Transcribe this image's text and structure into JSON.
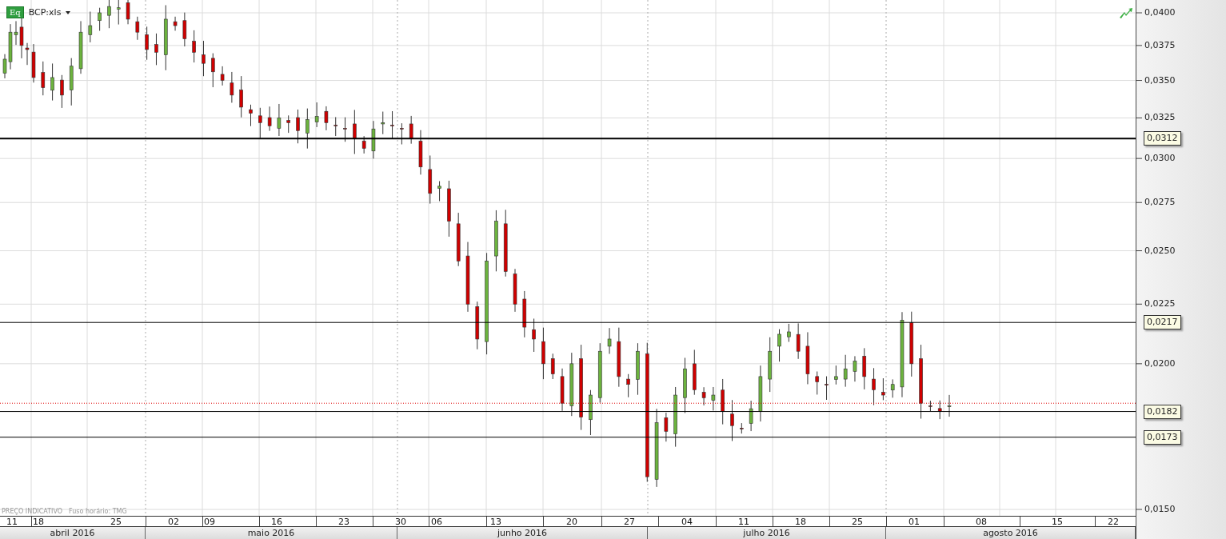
{
  "header": {
    "badge": "Eq",
    "symbol": "BCP:xls"
  },
  "y_axis": {
    "tick_labels": [
      "0,0400",
      "0,0375",
      "0,0350",
      "0,0325",
      "0,0300",
      "0,0275",
      "0,0250",
      "0,0225",
      "0,0200",
      "0,0150"
    ]
  },
  "price_tags": [
    "0,0312",
    "0,0217",
    "0,0182",
    "0,0173"
  ],
  "footnote": [
    "PREÇO INDICATIVO",
    "Fuso horário: TMG"
  ],
  "dates": [
    "11",
    "18",
    "25",
    "02",
    "09",
    "16",
    "23",
    "30",
    "06",
    "13",
    "20",
    "27",
    "04",
    "11",
    "18",
    "25",
    "01",
    "08",
    "15",
    "22"
  ],
  "months": [
    "abril 2016",
    "maio 2016",
    "junho 2016",
    "julho 2016",
    "agosto 2016"
  ]
}
